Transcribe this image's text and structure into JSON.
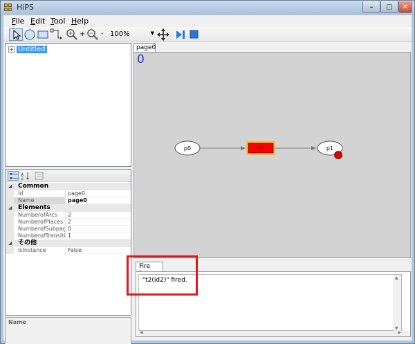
{
  "window": {
    "title": "HiPS"
  },
  "menu": {
    "items": [
      "File",
      "Edit",
      "Tool",
      "Help"
    ]
  },
  "toolbar": {
    "zoom_minus_label": "-",
    "zoom_plus_label": "+",
    "zoom_value": "100%"
  },
  "tree": {
    "root_label": "Untitled",
    "expander": "+"
  },
  "properties": {
    "categories": [
      {
        "name": "Common",
        "rows": [
          {
            "key": "Id",
            "value": "page0"
          },
          {
            "key": "Name",
            "value": "page0"
          }
        ]
      },
      {
        "name": "Elements",
        "rows": [
          {
            "key": "NumberofArcs",
            "value": "2"
          },
          {
            "key": "NumberofPlaces",
            "value": "2"
          },
          {
            "key": "NumberofSubpages",
            "value": "0"
          },
          {
            "key": "NumberofTransitions",
            "value": "1"
          }
        ]
      },
      {
        "name": "その他",
        "rows": [
          {
            "key": "IsInstance",
            "value": "False"
          }
        ]
      }
    ],
    "description_label": "Name"
  },
  "document": {
    "tab_label": "page0",
    "step_counter": "0"
  },
  "net": {
    "places": [
      {
        "label": "p0"
      },
      {
        "label": "p1",
        "token": true
      }
    ],
    "transitions": [
      {
        "label": "t2",
        "fill": "#ff0000",
        "highlight": "#f3c23a"
      }
    ]
  },
  "firelog": {
    "tab_label": "Fire Log",
    "log_text": "\"t2(id2)\" fired."
  },
  "colors": {
    "title_bar": "#aec6de",
    "canvas_bg": "#d3d3d3",
    "counter": "#1d3ed0",
    "transition_fill": "#ff0000",
    "annotation": "#e8141c"
  }
}
